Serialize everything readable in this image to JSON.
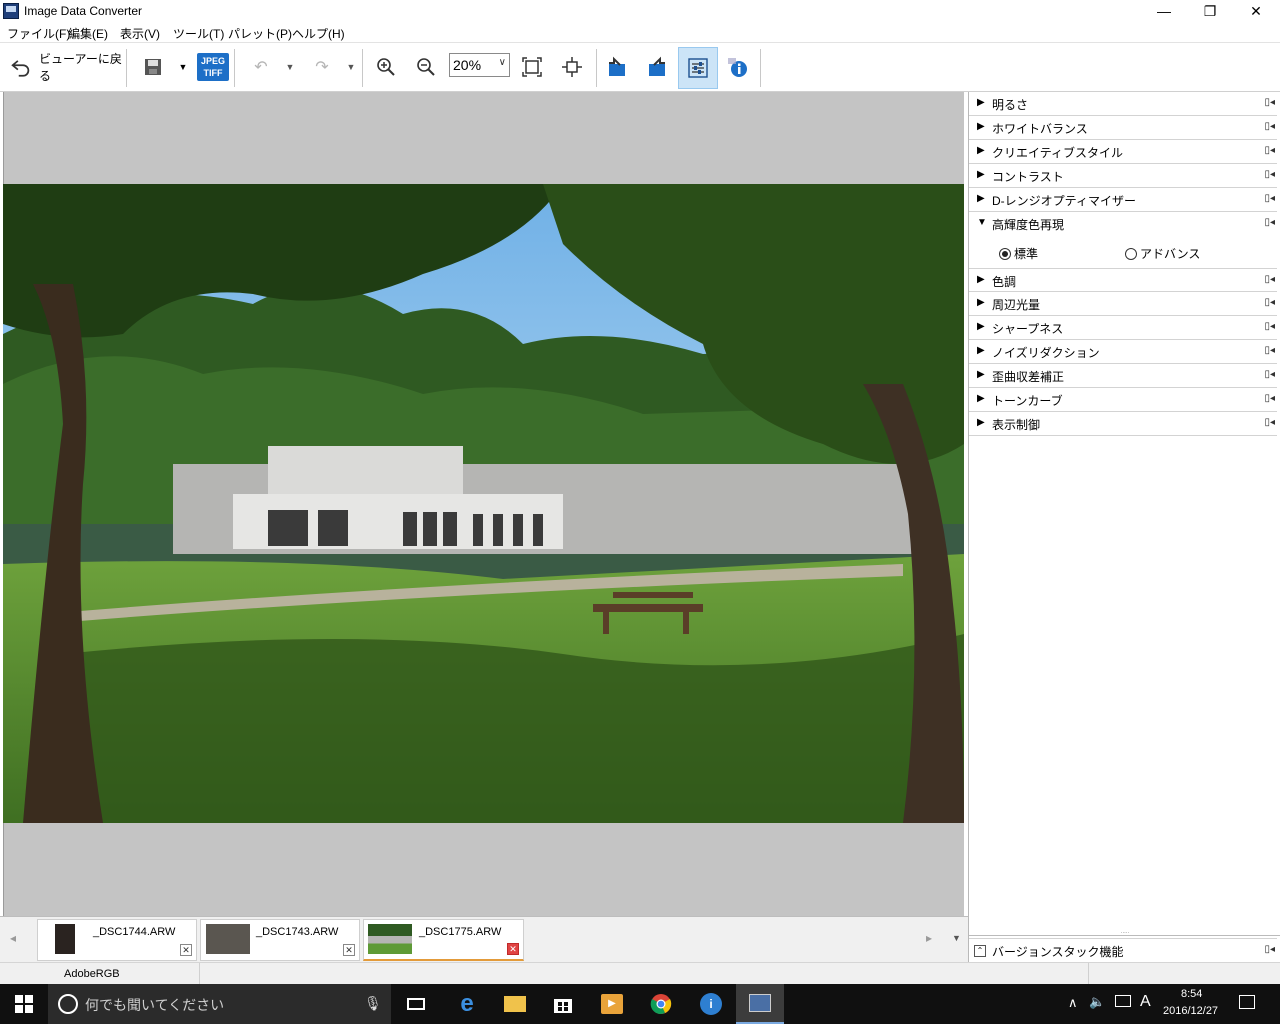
{
  "window": {
    "title": "Image Data Converter",
    "minimize": "—",
    "restore": "❐",
    "close": "✕"
  },
  "menu": [
    "ファイル(F)",
    "編集(E)",
    "表示(V)",
    "ツール(T)",
    "パレット(P)",
    "ヘルプ(H)"
  ],
  "toolbar": {
    "back_label": "ビューアーに戻る",
    "zoom_value": "20%",
    "jpeg_label": "JPEG",
    "tiff_label": "TIFF"
  },
  "panel": {
    "items": [
      {
        "label": "明るさ",
        "expanded": false
      },
      {
        "label": "ホワイトバランス",
        "expanded": false
      },
      {
        "label": "クリエイティブスタイル",
        "expanded": false
      },
      {
        "label": "コントラスト",
        "expanded": false
      },
      {
        "label": "D-レンジオプティマイザー",
        "expanded": false
      },
      {
        "label": "高輝度色再現",
        "expanded": true
      },
      {
        "label": "色調",
        "expanded": false
      },
      {
        "label": "周辺光量",
        "expanded": false
      },
      {
        "label": "シャープネス",
        "expanded": false
      },
      {
        "label": "ノイズリダクション",
        "expanded": false
      },
      {
        "label": "歪曲収差補正",
        "expanded": false
      },
      {
        "label": "トーンカーブ",
        "expanded": false
      },
      {
        "label": "表示制御",
        "expanded": false
      }
    ],
    "radio_standard": "標準",
    "radio_advanced": "アドバンス",
    "selected_radio": "標準",
    "version_stack": "バージョンスタック機能"
  },
  "filmstrip": {
    "files": [
      "_DSC1744.ARW",
      "_DSC1743.ARW",
      "_DSC1775.ARW"
    ],
    "active_index": 2
  },
  "status": {
    "color_space": "AdobeRGB"
  },
  "taskbar": {
    "search_placeholder": "何でも聞いてください",
    "time": "8:54",
    "date": "2016/12/27",
    "ime": "A"
  },
  "colors": {
    "accent_selected": "#cce4f7",
    "canvas_bg": "#c4c4c4",
    "close_red": "#e04343"
  }
}
